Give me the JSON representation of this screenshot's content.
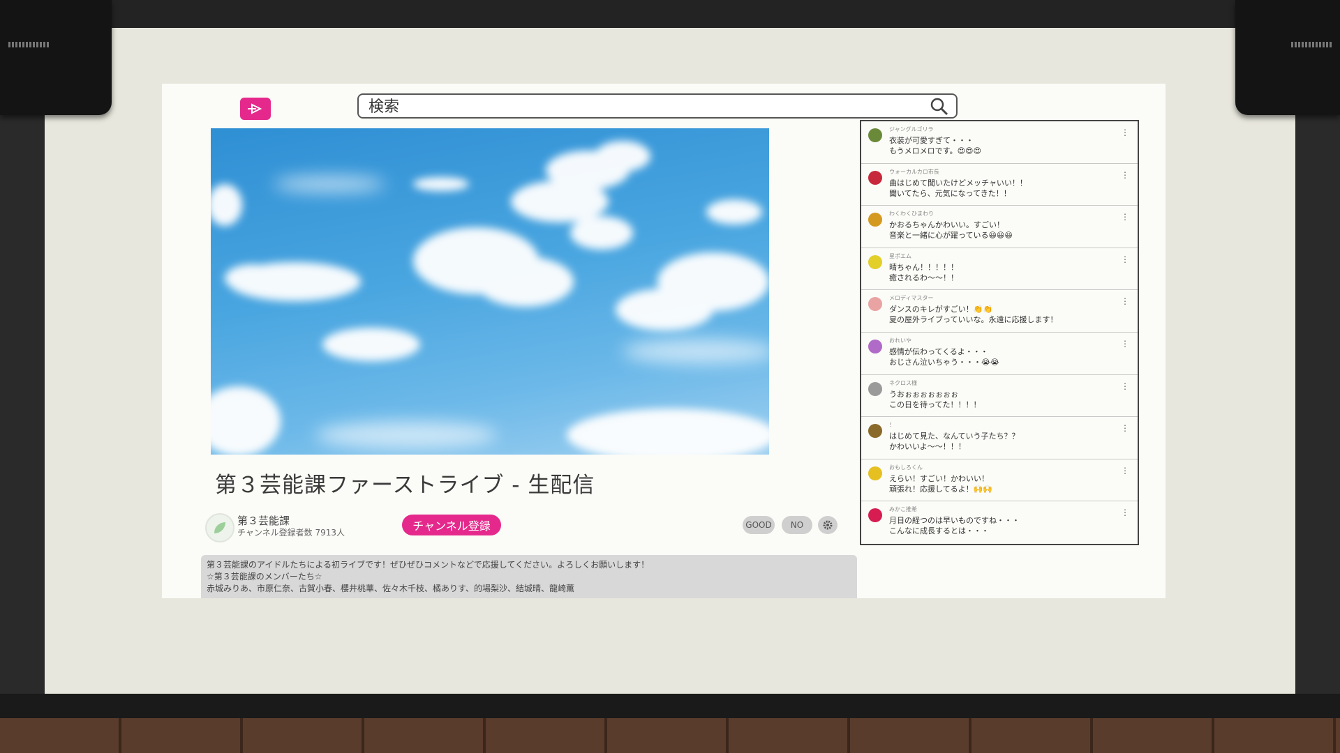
{
  "search": {
    "placeholder": "検索"
  },
  "video": {
    "title": "第３芸能課ファーストライブ - 生配信"
  },
  "channel": {
    "name": "第３芸能課",
    "subscribers": "チャンネル登録者数 7913人",
    "subscribe_label": "チャンネル登録"
  },
  "actions": {
    "good_label": "GOOD",
    "no_label": "NO"
  },
  "description": {
    "lines": [
      "第３芸能課のアイドルたちによる初ライブです！ぜひぜひコメントなどで応援してください。よろしくお願いします！",
      "☆第３芸能課のメンバーたち☆",
      "赤城みりあ、市原仁奈、古賀小春、櫻井桃華、佐々木千枝、橘ありす、的場梨沙、結城晴、龍崎薫"
    ]
  },
  "chat": {
    "messages": [
      {
        "user": "ジャングルゴリラ",
        "line1": "衣装が可愛すぎて・・・",
        "line2": "もうメロメロです。😍😍😍",
        "avatar_color": "#6a8a3a",
        "avatar_icon": "gorilla-icon"
      },
      {
        "user": "ウォーカルカロ市長",
        "line1": "曲はじめて聞いたけどメッチャいい！！",
        "line2": "聞いてたら、元気になってきた！！",
        "avatar_color": "#c8283c",
        "avatar_icon": "person-icon"
      },
      {
        "user": "わくわくひまわり",
        "line1": "かおるちゃんかわいい。すごい！",
        "line2": "音楽と一緒に心が躍っている😆😆😆",
        "avatar_color": "#d49a20",
        "avatar_icon": "sunflower-icon"
      },
      {
        "user": "星ポエム",
        "line1": "晴ちゃん！！！！！",
        "line2": "癒されるわ〜〜！！",
        "avatar_color": "#e3cf2a",
        "avatar_icon": "star-icon"
      },
      {
        "user": "メロディマスター",
        "line1": "ダンスのキレがすごい！👏👏",
        "line2": "夏の屋外ライブっていいな。永遠に応援します！",
        "avatar_color": "#e9a3a3",
        "avatar_icon": "music-note-icon"
      },
      {
        "user": "おれいや",
        "line1": "感情が伝わってくるよ・・・",
        "line2": "おじさん泣いちゃう・・・😭😭",
        "avatar_color": "#b06ac8",
        "avatar_icon": "face-icon"
      },
      {
        "user": "ネクロス様",
        "line1": "うおぉぉぉぉぉぉぉ",
        "line2": "この日を待ってた！！！！",
        "avatar_color": "#9a9a9a",
        "avatar_icon": "skull-icon"
      },
      {
        "user": "！",
        "line1": "はじめて見た、なんていう子たち？？",
        "line2": "かわいいよ〜〜！！！",
        "avatar_color": "#8a6a2a",
        "avatar_icon": "cat-icon"
      },
      {
        "user": "おもしろくん",
        "line1": "えらい！すごい！かわいい！",
        "line2": "頑張れ！応援してるよ！🙌🙌",
        "avatar_color": "#e5c020",
        "avatar_icon": "smile-icon"
      },
      {
        "user": "みかこ推希",
        "line1": "月日の経つのは早いものですね・・・",
        "line2": "こんなに成長するとは・・・",
        "avatar_color": "#d61c50",
        "avatar_icon": "exclamation-icon"
      }
    ]
  }
}
